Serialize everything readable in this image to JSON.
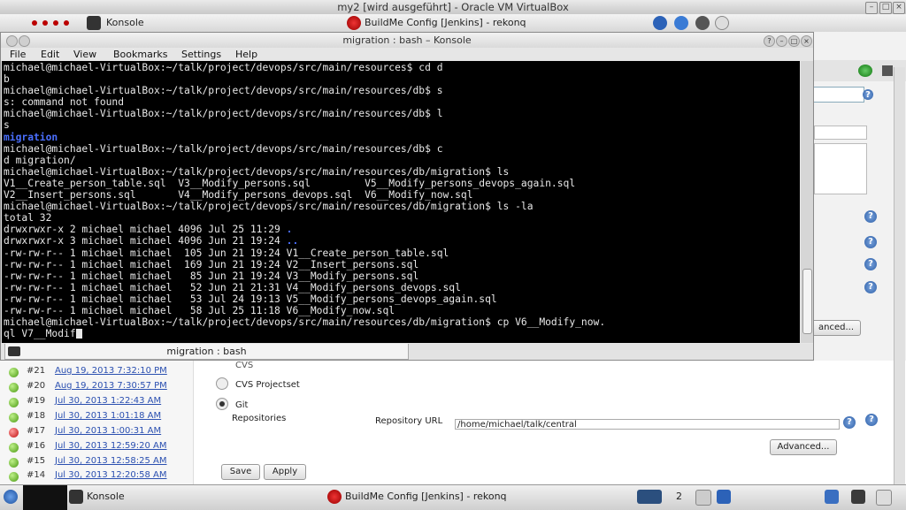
{
  "vbox": {
    "title": "my2 [wird ausgeführt] - Oracle VM VirtualBox"
  },
  "top_panel": {
    "konsole_label": "Konsole",
    "browser_label": "BuildMe Config [Jenkins] - rekonq"
  },
  "konsole": {
    "title": "migration : bash – Konsole",
    "menu": [
      "File",
      "Edit",
      "View",
      "Bookmarks",
      "Settings",
      "Help"
    ],
    "tab_label": "migration : bash",
    "lines": [
      {
        "text": "michael@michael-VirtualBox:~/talk/project/devops/src/main/resources$ cd d",
        "style": ""
      },
      {
        "text": "b",
        "style": ""
      },
      {
        "text": "michael@michael-VirtualBox:~/talk/project/devops/src/main/resources/db$ s",
        "style": ""
      },
      {
        "text": "s: command not found",
        "style": ""
      },
      {
        "text": "michael@michael-VirtualBox:~/talk/project/devops/src/main/resources/db$ l",
        "style": ""
      },
      {
        "text": "s",
        "style": ""
      },
      {
        "text": "migration",
        "style": "blue"
      },
      {
        "text": "michael@michael-VirtualBox:~/talk/project/devops/src/main/resources/db$ c",
        "style": ""
      },
      {
        "text": "d migration/",
        "style": ""
      },
      {
        "text": "michael@michael-VirtualBox:~/talk/project/devops/src/main/resources/db/migration$ ls",
        "style": ""
      },
      {
        "text": "V1__Create_person_table.sql  V3__Modify_persons.sql         V5__Modify_persons_devops_again.sql",
        "style": ""
      },
      {
        "text": "V2__Insert_persons.sql       V4__Modify_persons_devops.sql  V6__Modify_now.sql",
        "style": ""
      },
      {
        "text": "michael@michael-VirtualBox:~/talk/project/devops/src/main/resources/db/migration$ ls -la",
        "style": ""
      },
      {
        "text": "total 32",
        "style": ""
      },
      {
        "text": "drwxrwxr-x 2 michael michael 4096 Jul 25 11:29 ",
        "blue_tail": ".",
        "style": "mixed"
      },
      {
        "text": "drwxrwxr-x 3 michael michael 4096 Jun 21 19:24 ",
        "blue_tail": "..",
        "style": "mixed"
      },
      {
        "text": "-rw-rw-r-- 1 michael michael  105 Jun 21 19:24 V1__Create_person_table.sql",
        "style": ""
      },
      {
        "text": "-rw-rw-r-- 1 michael michael  169 Jun 21 19:24 V2__Insert_persons.sql",
        "style": ""
      },
      {
        "text": "-rw-rw-r-- 1 michael michael   85 Jun 21 19:24 V3__Modify_persons.sql",
        "style": ""
      },
      {
        "text": "-rw-rw-r-- 1 michael michael   52 Jun 21 21:31 V4__Modify_persons_devops.sql",
        "style": ""
      },
      {
        "text": "-rw-rw-r-- 1 michael michael   53 Jul 24 19:13 V5__Modify_persons_devops_again.sql",
        "style": ""
      },
      {
        "text": "-rw-rw-r-- 1 michael michael   58 Jul 25 11:18 V6__Modify_now.sql",
        "style": ""
      },
      {
        "text": "michael@michael-VirtualBox:~/talk/project/devops/src/main/resources/db/migration$ cp V6__Modify_now.",
        "style": ""
      },
      {
        "text": "ql V7__Modif",
        "style": "cursor"
      }
    ]
  },
  "jenkins": {
    "builds": [
      {
        "num": "#21",
        "date": "Aug 19, 2013 7:32:10 PM",
        "status": "success"
      },
      {
        "num": "#20",
        "date": "Aug 19, 2013 7:30:57 PM",
        "status": "success"
      },
      {
        "num": "#19",
        "date": "Jul 30, 2013 1:22:43 AM",
        "status": "success"
      },
      {
        "num": "#18",
        "date": "Jul 30, 2013 1:01:18 AM",
        "status": "success"
      },
      {
        "num": "#17",
        "date": "Jul 30, 2013 1:00:31 AM",
        "status": "failed"
      },
      {
        "num": "#16",
        "date": "Jul 30, 2013 12:59:20 AM",
        "status": "success"
      },
      {
        "num": "#15",
        "date": "Jul 30, 2013 12:58:25 AM",
        "status": "success"
      },
      {
        "num": "#14",
        "date": "Jul 30, 2013 12:20:58 AM",
        "status": "success"
      }
    ],
    "scm_cvs_partial": "CVS",
    "scm_cvs_projectset": "CVS Projectset",
    "scm_git": "Git",
    "repositories_label": "Repositories",
    "repo_url_label": "Repository URL",
    "repo_url_value": "/home/michael/talk/central",
    "advanced_label": "Advanced...",
    "advanced_partial": "anced...",
    "save_label": "Save",
    "apply_label": "Apply",
    "help_glyph": "?"
  },
  "taskbar": {
    "konsole_label": "Konsole",
    "browser_label": "BuildMe Config [Jenkins] - rekonq",
    "desktop_num": "2"
  },
  "colors": {
    "terminal_bg": "#000000",
    "terminal_fg": "#e8e8e8",
    "dir_blue": "#4a6fff",
    "link_blue": "#2a4fb0",
    "success": "#4a9a12",
    "failed": "#c01010"
  }
}
